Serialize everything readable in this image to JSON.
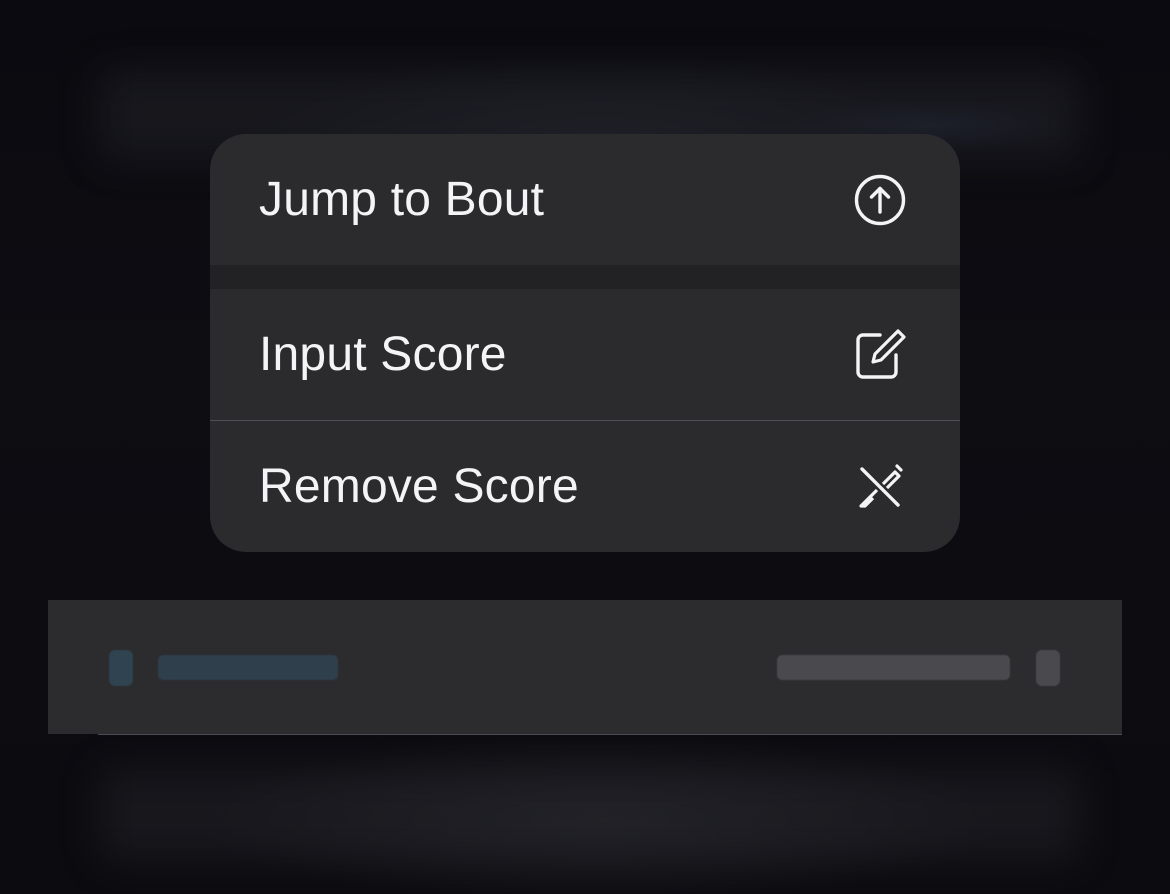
{
  "menu": {
    "items": [
      {
        "label": "Jump to Bout",
        "icon": "arrow-up-circle-icon"
      },
      {
        "label": "Input Score",
        "icon": "square-and-pencil-icon"
      },
      {
        "label": "Remove Score",
        "icon": "pencil-slash-icon"
      }
    ]
  },
  "colors": {
    "menu_background": "#2b2b2e",
    "menu_text": "#f4f4f6",
    "backdrop": "#07070b",
    "cell_background": "#2c2c2f"
  }
}
